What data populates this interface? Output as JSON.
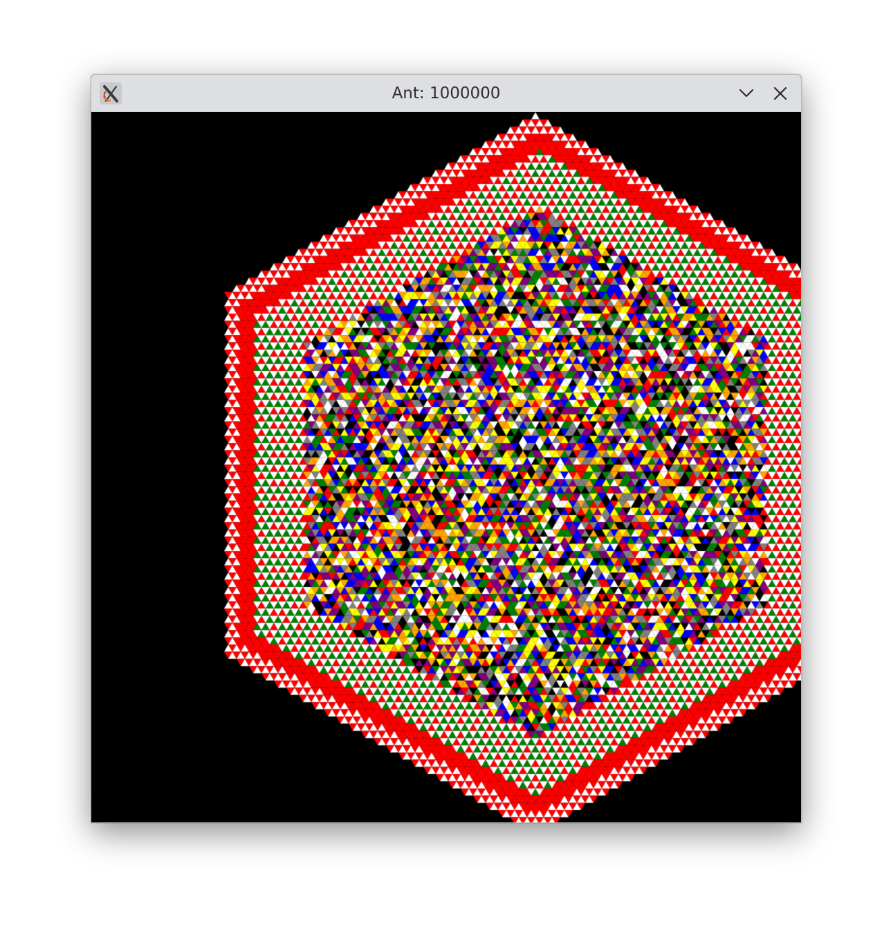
{
  "window": {
    "title": "Ant: 1000000"
  },
  "icons": {
    "app": "x-logo-icon",
    "minimize": "chevron-down-icon",
    "close": "close-icon"
  },
  "colors": {
    "background": "#000000",
    "palette": [
      "#ffffff",
      "#ff0000",
      "#008000",
      "#0000ff",
      "#ffff00",
      "#ffa500",
      "#800080",
      "#808080",
      "#000000"
    ]
  }
}
